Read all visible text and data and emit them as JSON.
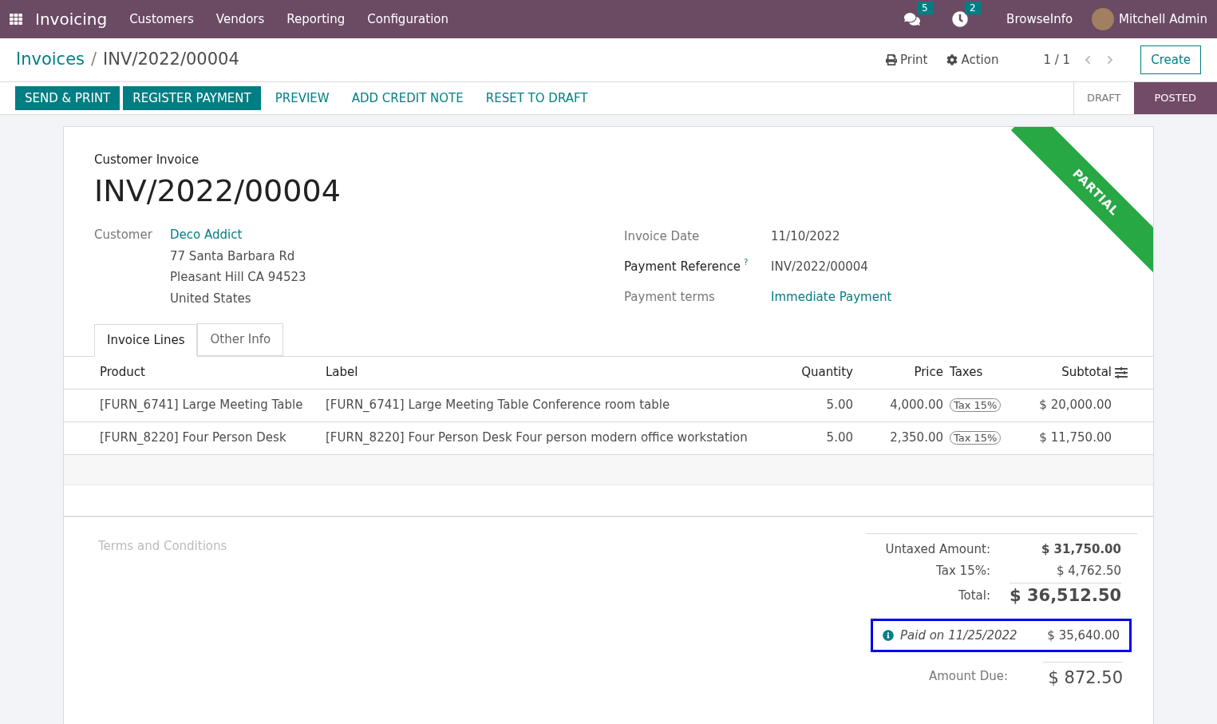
{
  "navbar": {
    "app": "Invoicing",
    "menus": [
      "Customers",
      "Vendors",
      "Reporting",
      "Configuration"
    ],
    "messages_count": "5",
    "activities_count": "2",
    "company": "BrowseInfo",
    "user": "Mitchell Admin"
  },
  "breadcrumb": {
    "parent": "Invoices",
    "separator": "/",
    "current": "INV/2022/00004"
  },
  "control_panel": {
    "print": "Print",
    "action": "Action",
    "pager": "1 / 1",
    "create": "Create"
  },
  "action_buttons": [
    {
      "label": "SEND & PRINT",
      "kind": "primary"
    },
    {
      "label": "REGISTER PAYMENT",
      "kind": "primary"
    },
    {
      "label": "PREVIEW",
      "kind": "link"
    },
    {
      "label": "ADD CREDIT NOTE",
      "kind": "link"
    },
    {
      "label": "RESET TO DRAFT",
      "kind": "link"
    }
  ],
  "stages": [
    {
      "label": "DRAFT",
      "selected": false
    },
    {
      "label": "POSTED",
      "selected": true
    }
  ],
  "sheet": {
    "ribbon": "PARTIAL",
    "type": "Customer Invoice",
    "number": "INV/2022/00004",
    "customer": {
      "label": "Customer",
      "name": "Deco Addict",
      "address": [
        "77 Santa Barbara Rd",
        "Pleasant Hill CA 94523",
        "United States"
      ]
    },
    "fields": [
      {
        "label": "Invoice Date",
        "value": "11/10/2022",
        "kind": "text",
        "help": false
      },
      {
        "label": "Payment Reference",
        "value": "INV/2022/00004",
        "kind": "text",
        "help": true
      },
      {
        "label": "Payment terms",
        "value": "Immediate Payment",
        "kind": "link",
        "help": false
      }
    ],
    "help_mark": "?"
  },
  "tabs": [
    {
      "label": "Invoice Lines",
      "selected": true
    },
    {
      "label": "Other Info",
      "selected": false
    }
  ],
  "table": {
    "columns": [
      "Product",
      "Label",
      "Quantity",
      "Price",
      "Taxes",
      "Subtotal"
    ],
    "rows": [
      {
        "product": "[FURN_6741] Large Meeting Table",
        "label": "[FURN_6741] Large Meeting Table Conference room table",
        "quantity": "5.00",
        "price": "4,000.00",
        "tax": "Tax 15%",
        "subtotal": "$ 20,000.00"
      },
      {
        "product": "[FURN_8220] Four Person Desk",
        "label": "[FURN_8220] Four Person Desk Four person modern office workstation",
        "quantity": "5.00",
        "price": "2,350.00",
        "tax": "Tax 15%",
        "subtotal": "$ 11,750.00"
      }
    ]
  },
  "terms_placeholder": "Terms and Conditions",
  "totals": {
    "untaxed_label": "Untaxed Amount:",
    "untaxed": "$ 31,750.00",
    "tax_label": "Tax 15%:",
    "tax": "$ 4,762.50",
    "total_label": "Total:",
    "total": "$ 36,512.50",
    "payment": {
      "label": "Paid on 11/25/2022",
      "amount": "$ 35,640.00"
    },
    "due_label": "Amount Due:",
    "due": "$ 872.50"
  }
}
